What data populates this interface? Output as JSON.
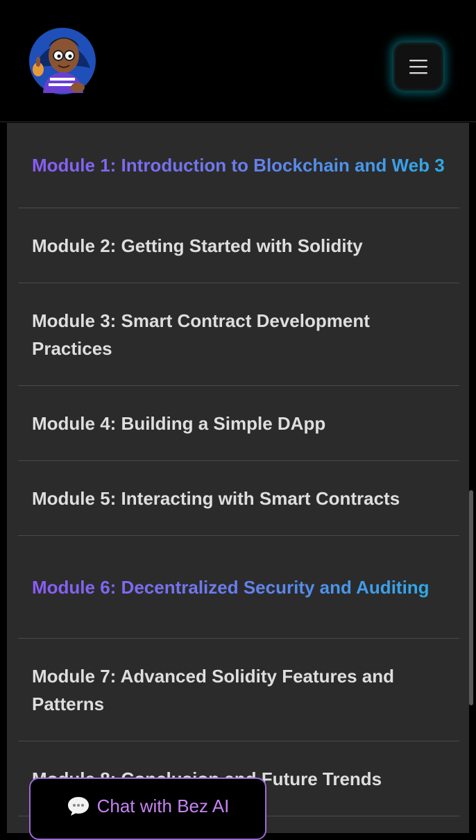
{
  "header": {
    "logo_icon": "cartoon-mascot-logo",
    "menu_icon": "hamburger-menu-icon",
    "accent_glow": "#00aabe"
  },
  "modules": [
    {
      "title": "Module 1: Introduction to Blockchain and Web 3",
      "highlighted": true
    },
    {
      "title": "Module 2: Getting Started with Solidity",
      "highlighted": false
    },
    {
      "title": "Module 3: Smart Contract Development Practices",
      "highlighted": false
    },
    {
      "title": "Module 4: Building a Simple DApp",
      "highlighted": false
    },
    {
      "title": "Module 5: Interacting with Smart Contracts",
      "highlighted": false
    },
    {
      "title": "Module 6: Decentralized Security and Auditing",
      "highlighted": true
    },
    {
      "title": "Module 7: Advanced Solidity Features and Patterns",
      "highlighted": false
    },
    {
      "title": "Module 8: Conclusion and Future Trends",
      "highlighted": false
    }
  ],
  "chat": {
    "label": "Chat with Bez AI",
    "icon": "speech-bubble-icon"
  },
  "colors": {
    "background": "#000000",
    "panel": "#2b2b2b",
    "text": "#dedede",
    "accent_start": "#8a5cf5",
    "accent_end": "#2fa9e8",
    "chat_border": "#9c6ad8",
    "chat_text": "#c583f2"
  }
}
